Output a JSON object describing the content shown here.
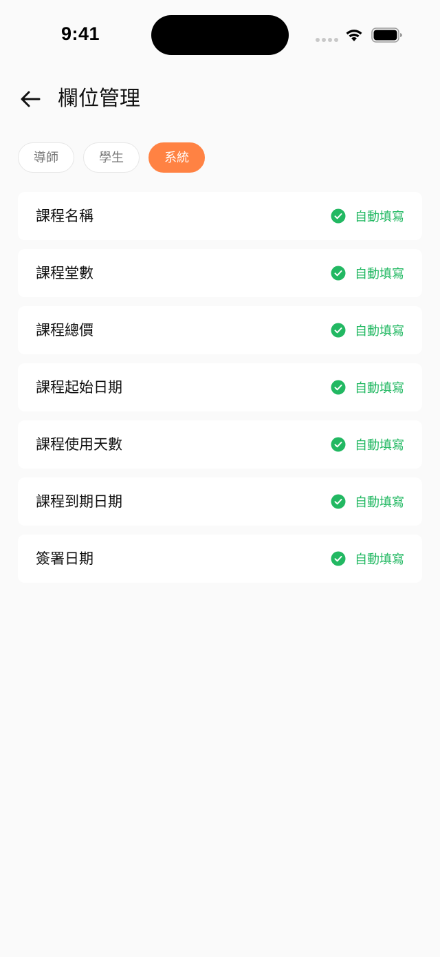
{
  "status_bar": {
    "time": "9:41",
    "icons": [
      "signal-dots-icon",
      "wifi-icon",
      "battery-icon"
    ]
  },
  "header": {
    "back_icon": "arrow-left-icon",
    "title": "欄位管理"
  },
  "tabs": [
    {
      "label": "導師",
      "active": false
    },
    {
      "label": "學生",
      "active": false
    },
    {
      "label": "系統",
      "active": true
    }
  ],
  "fields": [
    {
      "label": "課程名稱",
      "status": "自動填寫"
    },
    {
      "label": "課程堂數",
      "status": "自動填寫"
    },
    {
      "label": "課程總價",
      "status": "自動填寫"
    },
    {
      "label": "課程起始日期",
      "status": "自動填寫"
    },
    {
      "label": "課程使用天數",
      "status": "自動填寫"
    },
    {
      "label": "課程到期日期",
      "status": "自動填寫"
    },
    {
      "label": "簽署日期",
      "status": "自動填寫"
    }
  ],
  "colors": {
    "accent": "#ff8243",
    "success": "#22b862",
    "background": "#fafafa",
    "card": "#ffffff"
  }
}
